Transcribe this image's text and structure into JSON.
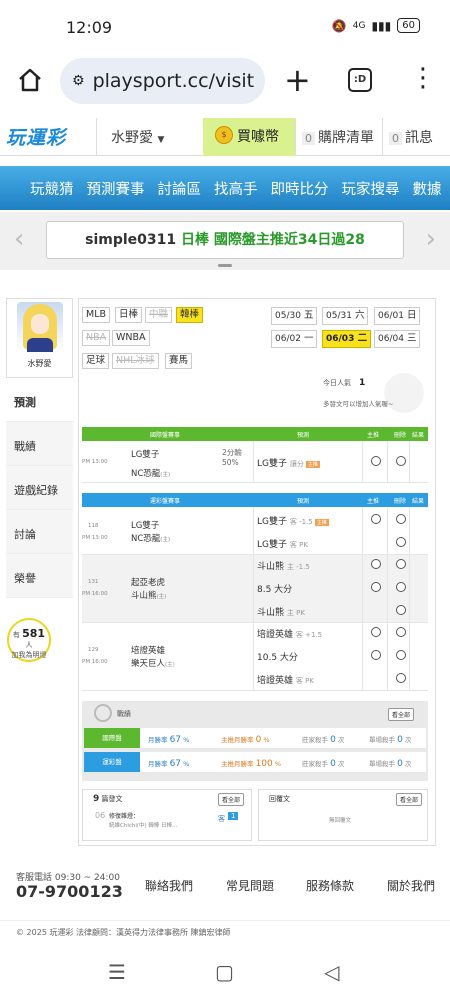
{
  "status_bar": {
    "time": "12:09",
    "battery": "60",
    "network": "4G"
  },
  "browser": {
    "url": "playsport.cc/visit",
    "tabs_label": ":D"
  },
  "header": {
    "logo": "玩運彩",
    "user": "水野愛",
    "buy_label": "買噱幣",
    "cart_count": "0",
    "cart_label": "購牌清單",
    "msg_count": "0",
    "msg_label": "訊息"
  },
  "nav": [
    "玩競猜",
    "預測賽事",
    "討論區",
    "找高手",
    "即時比分",
    "玩家搜尋",
    "數據"
  ],
  "banner": {
    "user": "simple0311",
    "text": " 日棒 國際盤主推近34日過28"
  },
  "profile": {
    "name": "水野愛"
  },
  "side_tabs": [
    "預測",
    "戰績",
    "遊戲紀錄",
    "討論",
    "榮譽"
  ],
  "bulb": {
    "prefix": "有",
    "count": "581",
    "suffix": "人",
    "line2": "加我為明燈"
  },
  "leagues": [
    {
      "label": "MLB",
      "state": "normal"
    },
    {
      "label": "日棒",
      "state": "normal"
    },
    {
      "label": "中職",
      "state": "disabled"
    },
    {
      "label": "韓棒",
      "state": "selected"
    },
    {
      "label": "NBA",
      "state": "disabled"
    },
    {
      "label": "WNBA",
      "state": "normal"
    },
    {
      "label": "足球",
      "state": "normal"
    },
    {
      "label": "NHL冰球",
      "state": "disabled"
    },
    {
      "label": "賽馬",
      "state": "normal"
    }
  ],
  "dates": [
    {
      "md": "05/30",
      "wd": "五"
    },
    {
      "md": "05/31",
      "wd": "六"
    },
    {
      "md": "06/01",
      "wd": "日"
    },
    {
      "md": "06/02",
      "wd": "一"
    },
    {
      "md": "06/03",
      "wd": "二",
      "selected": true
    },
    {
      "md": "06/04",
      "wd": "三"
    }
  ],
  "popularity": {
    "label": "今日人氣",
    "value": "1",
    "note": "多發文可以增加人氣喔~"
  },
  "intl_table": {
    "headers": [
      "國際盤賽事",
      "預測",
      "主推",
      "刪除",
      "結果"
    ],
    "game": {
      "time": "PM 13:00",
      "team1": "LG雙子",
      "team2": "NC恐龍",
      "team2_tag": "(主)",
      "line": "2分輸",
      "pct": "50%",
      "pick": "LG雙子",
      "pick_side": "讓分"
    }
  },
  "local_table": {
    "headers": [
      "運彩盤賽事",
      "預測",
      "主推",
      "刪除",
      "結果"
    ],
    "games": [
      {
        "no": "118",
        "time": "PM 13:00",
        "team1": "LG雙子",
        "team2": "NC恐龍",
        "team2_tag": "(主)",
        "picks": [
          {
            "t": "LG雙子",
            "s": "客 -1.5",
            "tag": true
          },
          {
            "t": "LG雙子",
            "s": "客 PK"
          }
        ]
      },
      {
        "no": "131",
        "time": "PM 16:00",
        "team1": "起亞老虎",
        "team2": "斗山熊",
        "team2_tag": "(主)",
        "picks": [
          {
            "t": "斗山熊",
            "s": "主 -1.5"
          },
          {
            "t": "8.5 大分",
            "s": ""
          },
          {
            "t": "斗山熊",
            "s": "主 PK"
          }
        ]
      },
      {
        "no": "129",
        "time": "PM 16:00",
        "team1": "培證英雄",
        "team2": "樂天巨人",
        "team2_tag": "(主)",
        "picks": [
          {
            "t": "培證英雄",
            "s": "客 +1.5"
          },
          {
            "t": "10.5 大分",
            "s": ""
          },
          {
            "t": "培證英雄",
            "s": "客 PK"
          }
        ]
      }
    ]
  },
  "stats": {
    "title": "戰績",
    "view_all": "看全部",
    "rows": [
      {
        "label": "國際盤",
        "color": "#5cb82e",
        "a": "月勝率",
        "av": "67",
        "au": "%",
        "b": "主推月勝率",
        "bv": "0",
        "bu": "%",
        "c": "莊家殺手",
        "cv": "0",
        "cu": "次",
        "d": "單場殺手",
        "dv": "0",
        "du": "次"
      },
      {
        "label": "運彩盤",
        "color": "#2b9de0",
        "a": "月勝率",
        "av": "67",
        "au": "%",
        "b": "主推月勝率",
        "bv": "100",
        "bu": "%",
        "c": "莊家殺手",
        "cv": "0",
        "cu": "次",
        "d": "單場殺手",
        "dv": "0",
        "du": "次"
      }
    ]
  },
  "posts": {
    "count": "9",
    "title": "篇發文",
    "view_all": "看全部",
    "item_date": "06",
    "item_title": "修復雜燈：",
    "item_sub": "統雄Chichi(中) 韓棒 日棒...",
    "item_tag": "客",
    "item_num": "1"
  },
  "replies": {
    "title": "回覆文",
    "view_all": "看全部",
    "empty": "無回覆文"
  },
  "footer": {
    "tel_label": "客服電話 09:30 ~ 24:00",
    "tel": "07-9700123",
    "links": [
      "聯絡我們",
      "常見問題",
      "服務條款",
      "關於我們"
    ],
    "copy": "© 2025 玩運彩 法律顧問：漢英得力法律事務所 陳鎮宏律師"
  }
}
